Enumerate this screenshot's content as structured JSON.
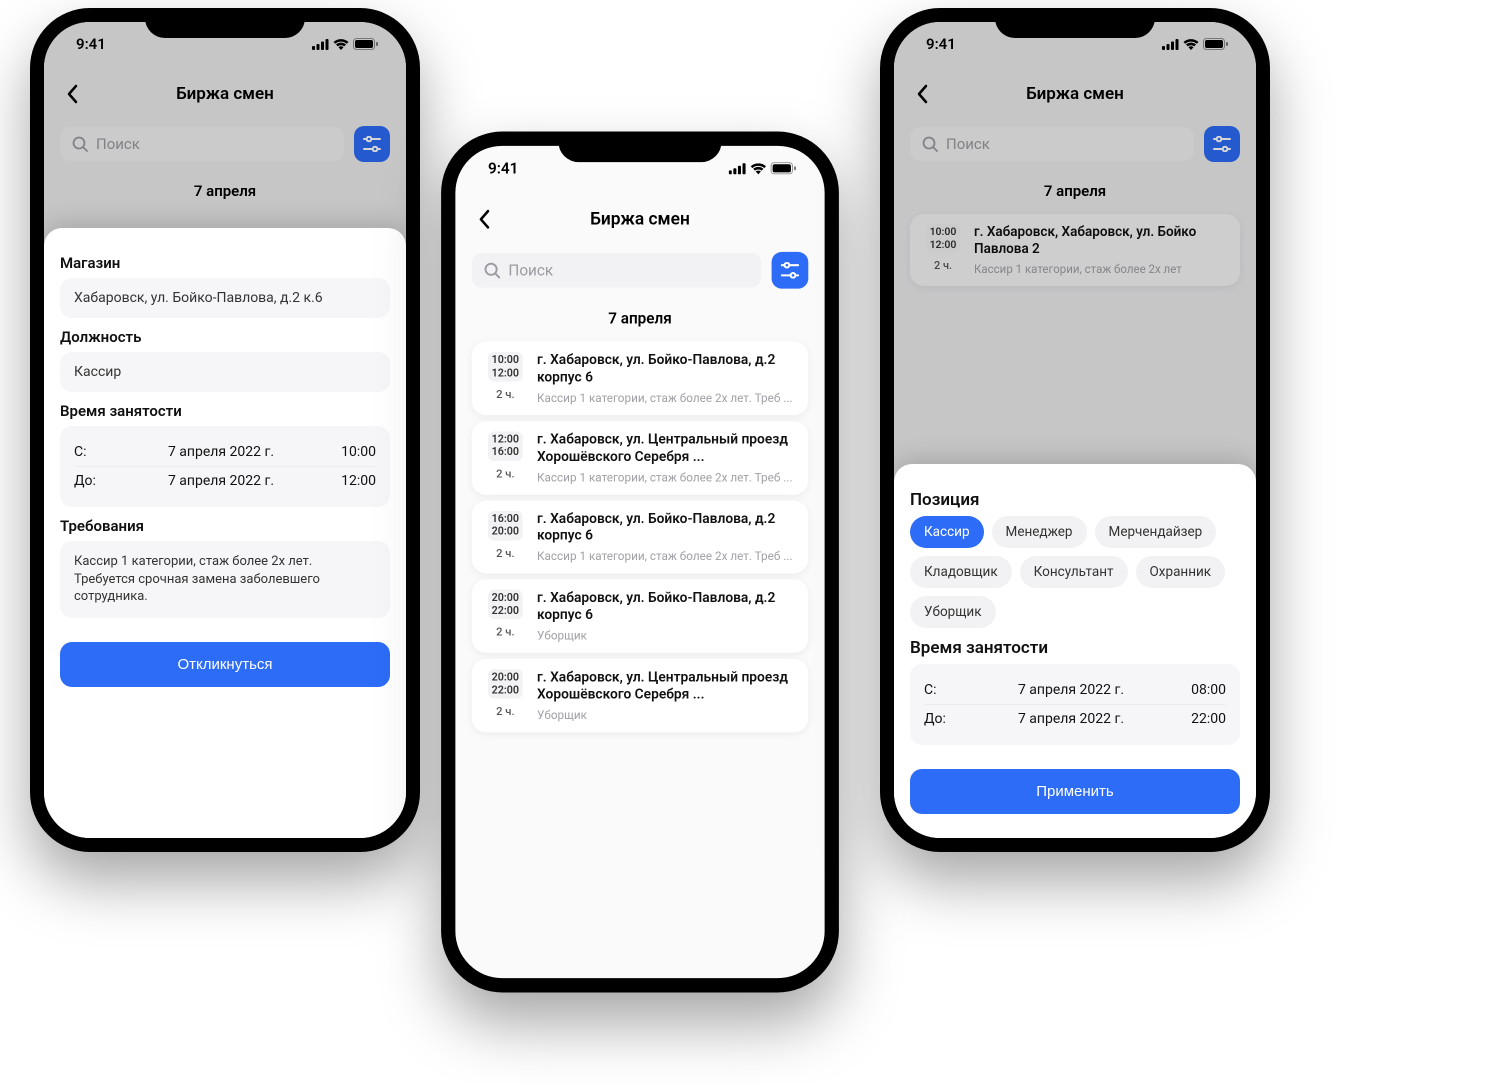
{
  "status": {
    "time": "9:41"
  },
  "nav": {
    "title": "Биржа смен"
  },
  "search": {
    "placeholder": "Поиск"
  },
  "date_header": "7 апреля",
  "preview_card": {
    "start": "10:00",
    "end": "12:00",
    "duration": "2 ч.",
    "address": "г. Хабаровск, Хабаровск, ул. Бойко Павлова 2",
    "subtitle": "Кассир 1 категории, стаж более 2х лет"
  },
  "shifts": [
    {
      "start": "10:00",
      "end": "12:00",
      "duration": "2 ч.",
      "address": "г. Хабаровск, ул. Бойко-Павлова, д.2 корпус 6",
      "subtitle": "Кассир 1 категории, стаж более 2х лет. Треб ..."
    },
    {
      "start": "12:00",
      "end": "16:00",
      "duration": "2 ч.",
      "address": "г. Хабаровск, ул. Центральный проезд Хорошёвского Серебря ...",
      "subtitle": "Кассир 1 категории, стаж более 2х лет. Треб ..."
    },
    {
      "start": "16:00",
      "end": "20:00",
      "duration": "2 ч.",
      "address": "г. Хабаровск, ул. Бойко-Павлова, д.2 корпус 6",
      "subtitle": "Кассир 1 категории, стаж более 2х лет. Треб ..."
    },
    {
      "start": "20:00",
      "end": "22:00",
      "duration": "2 ч.",
      "address": "г. Хабаровск, ул. Бойко-Павлова, д.2 корпус 6",
      "subtitle": "Уборщик"
    },
    {
      "start": "20:00",
      "end": "22:00",
      "duration": "2 ч.",
      "address": "г. Хабаровск, ул. Центральный проезд Хорошёвского Серебря ...",
      "subtitle": "Уборщик"
    }
  ],
  "detail_sheet": {
    "labels": {
      "store": "Магазин",
      "position": "Должность",
      "time": "Время занятости",
      "from": "С:",
      "to": "До:",
      "requirements": "Требования"
    },
    "store": "Хабаровск, ул. Бойко-Павлова, д.2 к.6",
    "position": "Кассир",
    "from_date": "7 апреля 2022 г.",
    "from_time": "10:00",
    "to_date": "7 апреля 2022 г.",
    "to_time": "12:00",
    "requirements": "Кассир 1 категории, стаж более 2х лет. Требуется срочная замена заболевшего сотрудника.",
    "cta": "Откликнуться"
  },
  "filter_sheet": {
    "labels": {
      "position": "Позиция",
      "time": "Время занятости",
      "from": "С:",
      "to": "До:"
    },
    "chips": [
      "Кассир",
      "Менеджер",
      "Мерчендайзер",
      "Кладовщик",
      "Консультант",
      "Охранник",
      "Уборщик"
    ],
    "active_chip": "Кассир",
    "from_date": "7 апреля 2022 г.",
    "from_time": "08:00",
    "to_date": "7 апреля 2022 г.",
    "to_time": "22:00",
    "cta": "Применить"
  }
}
